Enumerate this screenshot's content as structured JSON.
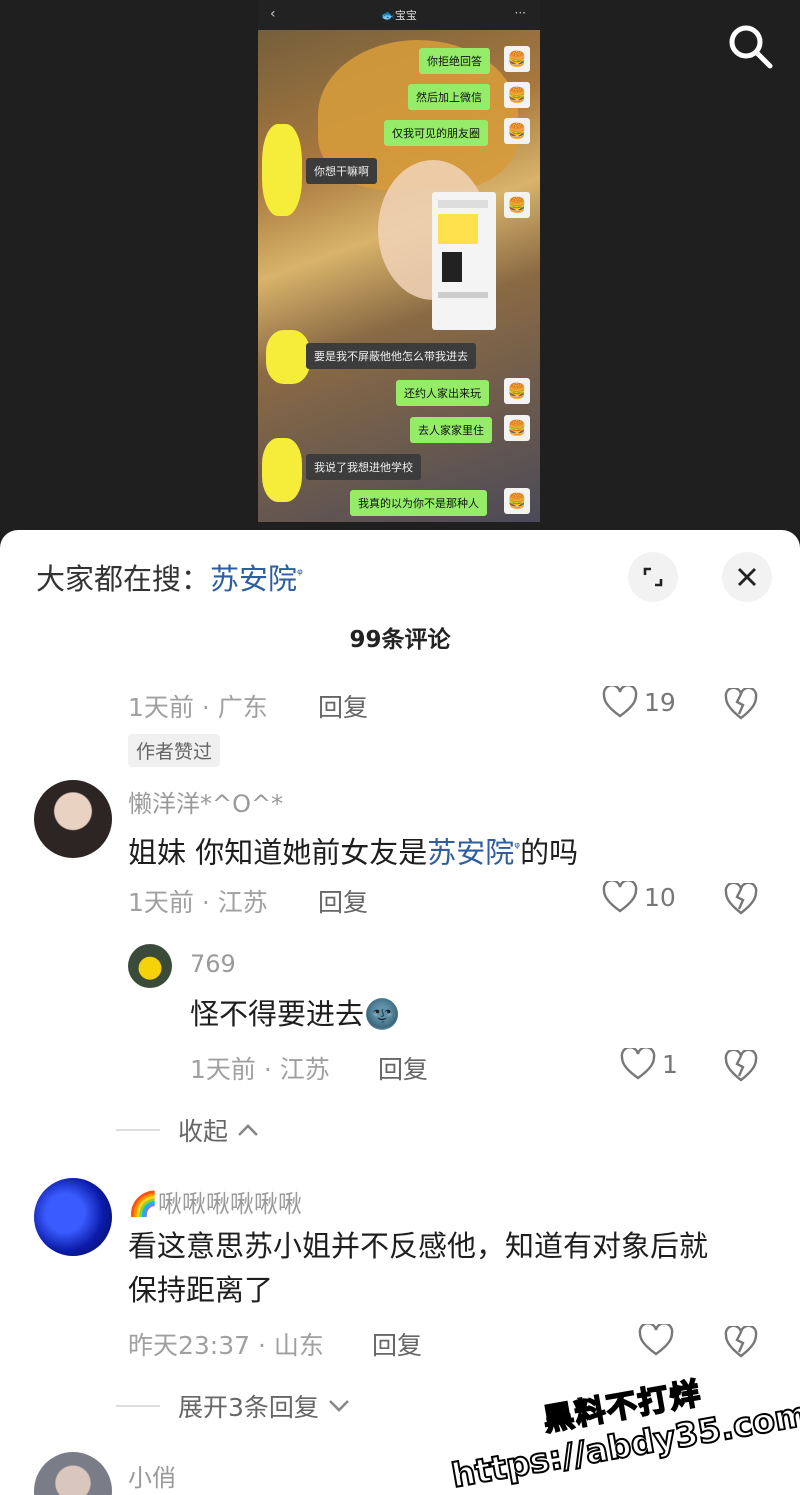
{
  "video": {
    "back_glyph": "‹",
    "chat_title": "🐟宝宝",
    "more_glyph": "···",
    "messages": [
      {
        "side": "me",
        "text": "你拒绝回答"
      },
      {
        "side": "me",
        "text": "然后加上微信"
      },
      {
        "side": "me",
        "text": "仅我可见的朋友圈"
      },
      {
        "side": "other",
        "text": "你想干嘛啊"
      },
      {
        "side": "other",
        "text": "要是我不屏蔽他他怎么带我进去"
      },
      {
        "side": "me",
        "text": "还约人家出来玩"
      },
      {
        "side": "me",
        "text": "去人家家里住"
      },
      {
        "side": "other",
        "text": "我说了我想进他学校"
      },
      {
        "side": "me",
        "text": "我真的以为你不是那种人"
      }
    ],
    "avatar_emoji": "🍔"
  },
  "sheet": {
    "search_prefix": "大家都在搜：",
    "search_keyword": "苏安院",
    "search_sup": "ᵠ",
    "comment_count": "99条评论",
    "reply_label": "回复"
  },
  "comments": [
    {
      "meta": "1天前 · 广东",
      "likes": "19",
      "badge": "作者赞过"
    },
    {
      "username": "懒洋洋*^O^*",
      "text_before": "姐妹 你知道她前女友是",
      "keyword": "苏安院",
      "text_after": "的吗",
      "meta": "1天前 · 江苏",
      "likes": "10"
    },
    {
      "username": "769",
      "text": "怪不得要进去",
      "emoji": "🌚",
      "meta": "1天前 · 江苏",
      "likes": "1"
    },
    {
      "username": "🌈啾啾啾啾啾啾",
      "text_line1": "看这意思苏小姐并不反感他，知道有对象后就",
      "text_line2": "保持距离了",
      "meta": "昨天23:37 · 山东",
      "likes": ""
    },
    {
      "username": "小俏"
    }
  ],
  "collapse_label": "收起",
  "expand_label": "展开3条回复",
  "watermark": {
    "line1": "黑料不打烊",
    "line2": "https://abdy35.com"
  },
  "colors": {
    "keyword": "#2e5e9e",
    "me_bubble": "#95ec69",
    "watermark_stroke": "#000000"
  }
}
